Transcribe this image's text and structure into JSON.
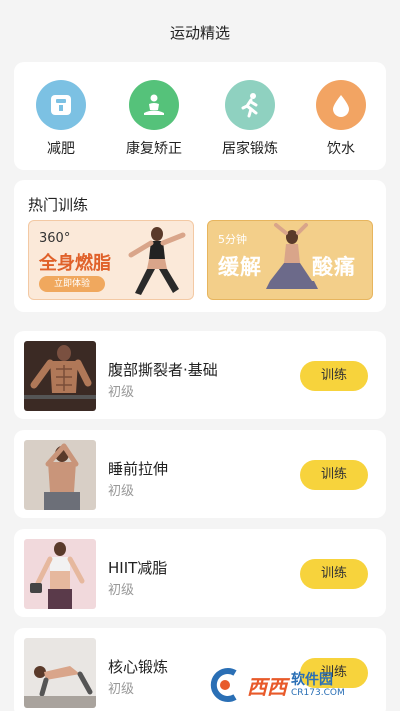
{
  "header": {
    "title": "运动精选"
  },
  "categories": [
    {
      "label": "减肥",
      "icon": "scale-icon",
      "color": "#7cc1e3"
    },
    {
      "label": "康复矫正",
      "icon": "meditation-icon",
      "color": "#55c27a"
    },
    {
      "label": "居家锻炼",
      "icon": "running-icon",
      "color": "#8fd1c0"
    },
    {
      "label": "饮水",
      "icon": "water-drop-icon",
      "color": "#f2a463"
    }
  ],
  "hot": {
    "title": "热门训练",
    "banners": [
      {
        "line1": "360°",
        "line2": "全身燃脂",
        "button": "立即体验"
      },
      {
        "line1": "5分钟",
        "line2a": "缓解",
        "line2b": "酸痛"
      }
    ]
  },
  "workouts": [
    {
      "name": "腹部撕裂者·基础",
      "level": "初级",
      "button": "训练"
    },
    {
      "name": "睡前拉伸",
      "level": "初级",
      "button": "训练"
    },
    {
      "name": "HIIT减脂",
      "level": "初级",
      "button": "训练"
    },
    {
      "name": "核心锻炼",
      "level": "初级",
      "button": "训练"
    }
  ],
  "watermark": {
    "brand": "西西",
    "text": "软件园",
    "url": "CR173.COM"
  },
  "colors": {
    "accent": "#f7d33c",
    "background": "#f4f4f4"
  }
}
